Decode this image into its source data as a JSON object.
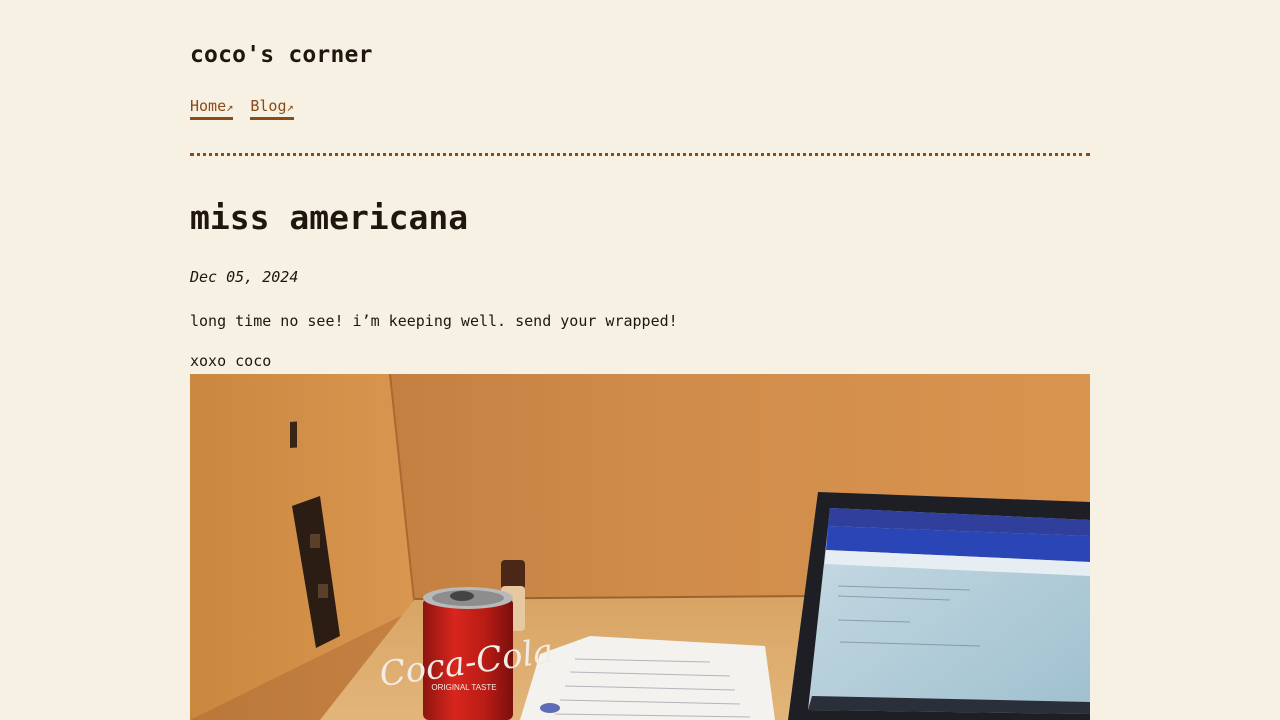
{
  "site": {
    "title": "coco's corner"
  },
  "nav": [
    {
      "label": "Home",
      "arrow": "↗"
    },
    {
      "label": "Blog",
      "arrow": "↗"
    }
  ],
  "post": {
    "title": "miss americana",
    "date": "Dec 05, 2024",
    "body": "long time no see! i’m keeping well. send your wrapped!",
    "signoff": "xoxo coco",
    "photo": {
      "can_text": "Coca-Cola",
      "can_subtext": "ORIGINAL TASTE"
    }
  },
  "colors": {
    "background": "#f7f1e3",
    "link": "#8a4b17",
    "text": "#1f170f"
  }
}
